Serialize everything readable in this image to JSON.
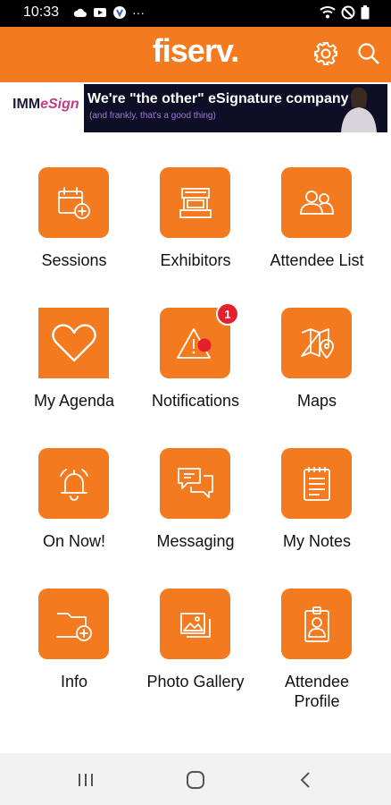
{
  "status_bar": {
    "time": "10:33",
    "more": "···"
  },
  "header": {
    "logo": "fiserv."
  },
  "banner": {
    "logo_prefix": "IMM",
    "logo_accent": "eSign",
    "headline": "We're \"the other\" eSignature company",
    "subline": "(and frankly, that's a good thing)"
  },
  "tiles": [
    {
      "label": "Sessions",
      "icon": "calendar-add-icon"
    },
    {
      "label": "Exhibitors",
      "icon": "booth-icon"
    },
    {
      "label": "Attendee List",
      "icon": "people-icon"
    },
    {
      "label": "My Agenda",
      "icon": "heart-icon"
    },
    {
      "label": "Notifications",
      "icon": "warning-icon",
      "badge": "1"
    },
    {
      "label": "Maps",
      "icon": "map-pin-icon"
    },
    {
      "label": "On Now!",
      "icon": "bell-ringing-icon"
    },
    {
      "label": "Messaging",
      "icon": "chat-bubbles-icon"
    },
    {
      "label": "My Notes",
      "icon": "notepad-icon"
    },
    {
      "label": "Info",
      "icon": "folder-add-icon"
    },
    {
      "label": "Photo Gallery",
      "icon": "photos-icon"
    },
    {
      "label": "Attendee Profile",
      "icon": "id-badge-icon"
    }
  ],
  "colors": {
    "brand": "#f47a20",
    "badge": "#e4202f",
    "banner_bg": "#0e0e26"
  }
}
